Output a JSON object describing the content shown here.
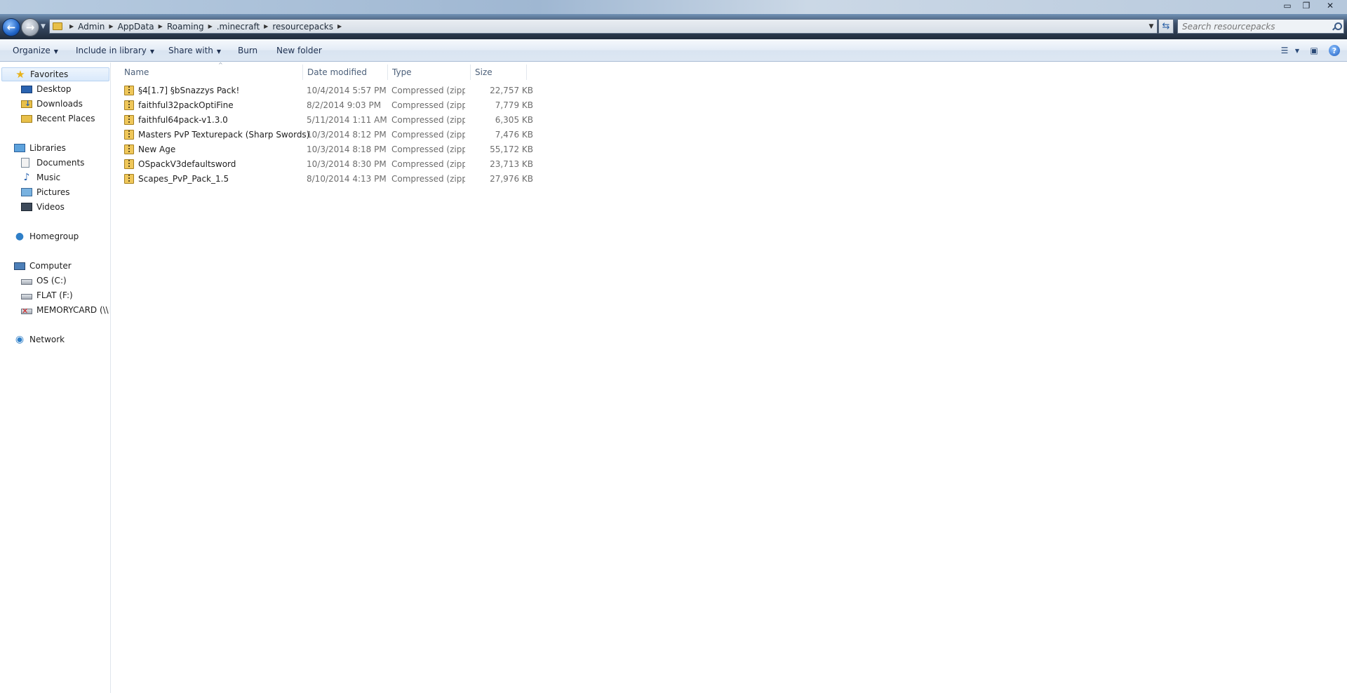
{
  "window": {
    "minimize_glyph": "▭",
    "restore_glyph": "❐",
    "close_glyph": "✕"
  },
  "address": {
    "breadcrumbs": [
      "Admin",
      "AppData",
      "Roaming",
      ".minecraft",
      "resourcepacks"
    ],
    "search_placeholder": "Search resourcepacks"
  },
  "toolbar": {
    "organize": "Organize",
    "include_in_library": "Include in library",
    "share_with": "Share with",
    "burn": "Burn",
    "new_folder": "New folder"
  },
  "navpane": {
    "favorites": "Favorites",
    "desktop": "Desktop",
    "downloads": "Downloads",
    "recent_places": "Recent Places",
    "libraries": "Libraries",
    "documents": "Documents",
    "music": "Music",
    "pictures": "Pictures",
    "videos": "Videos",
    "homegroup": "Homegroup",
    "computer": "Computer",
    "drive_c": "OS (C:)",
    "drive_f": "FLAT (F:)",
    "memorycard": "MEMORYCARD (\\\\E",
    "network": "Network"
  },
  "columns": {
    "name": "Name",
    "date": "Date modified",
    "type": "Type",
    "size": "Size"
  },
  "files": [
    {
      "name": "§4[1.7] §bSnazzys Pack!",
      "date": "10/4/2014 5:57 PM",
      "type": "Compressed (zipp...",
      "size": "22,757 KB"
    },
    {
      "name": "faithful32packOptiFine",
      "date": "8/2/2014 9:03 PM",
      "type": "Compressed (zipp...",
      "size": "7,779 KB"
    },
    {
      "name": "faithful64pack-v1.3.0",
      "date": "5/11/2014 1:11 AM",
      "type": "Compressed (zipp...",
      "size": "6,305 KB"
    },
    {
      "name": "Masters PvP Texturepack (Sharp Swords)",
      "date": "10/3/2014 8:12 PM",
      "type": "Compressed (zipp...",
      "size": "7,476 KB"
    },
    {
      "name": "New Age",
      "date": "10/3/2014 8:18 PM",
      "type": "Compressed (zipp...",
      "size": "55,172 KB"
    },
    {
      "name": "OSpackV3defaultsword",
      "date": "10/3/2014 8:30 PM",
      "type": "Compressed (zipp...",
      "size": "23,713 KB"
    },
    {
      "name": "Scapes_PvP_Pack_1.5",
      "date": "8/10/2014 4:13 PM",
      "type": "Compressed (zipp...",
      "size": "27,976 KB"
    }
  ]
}
